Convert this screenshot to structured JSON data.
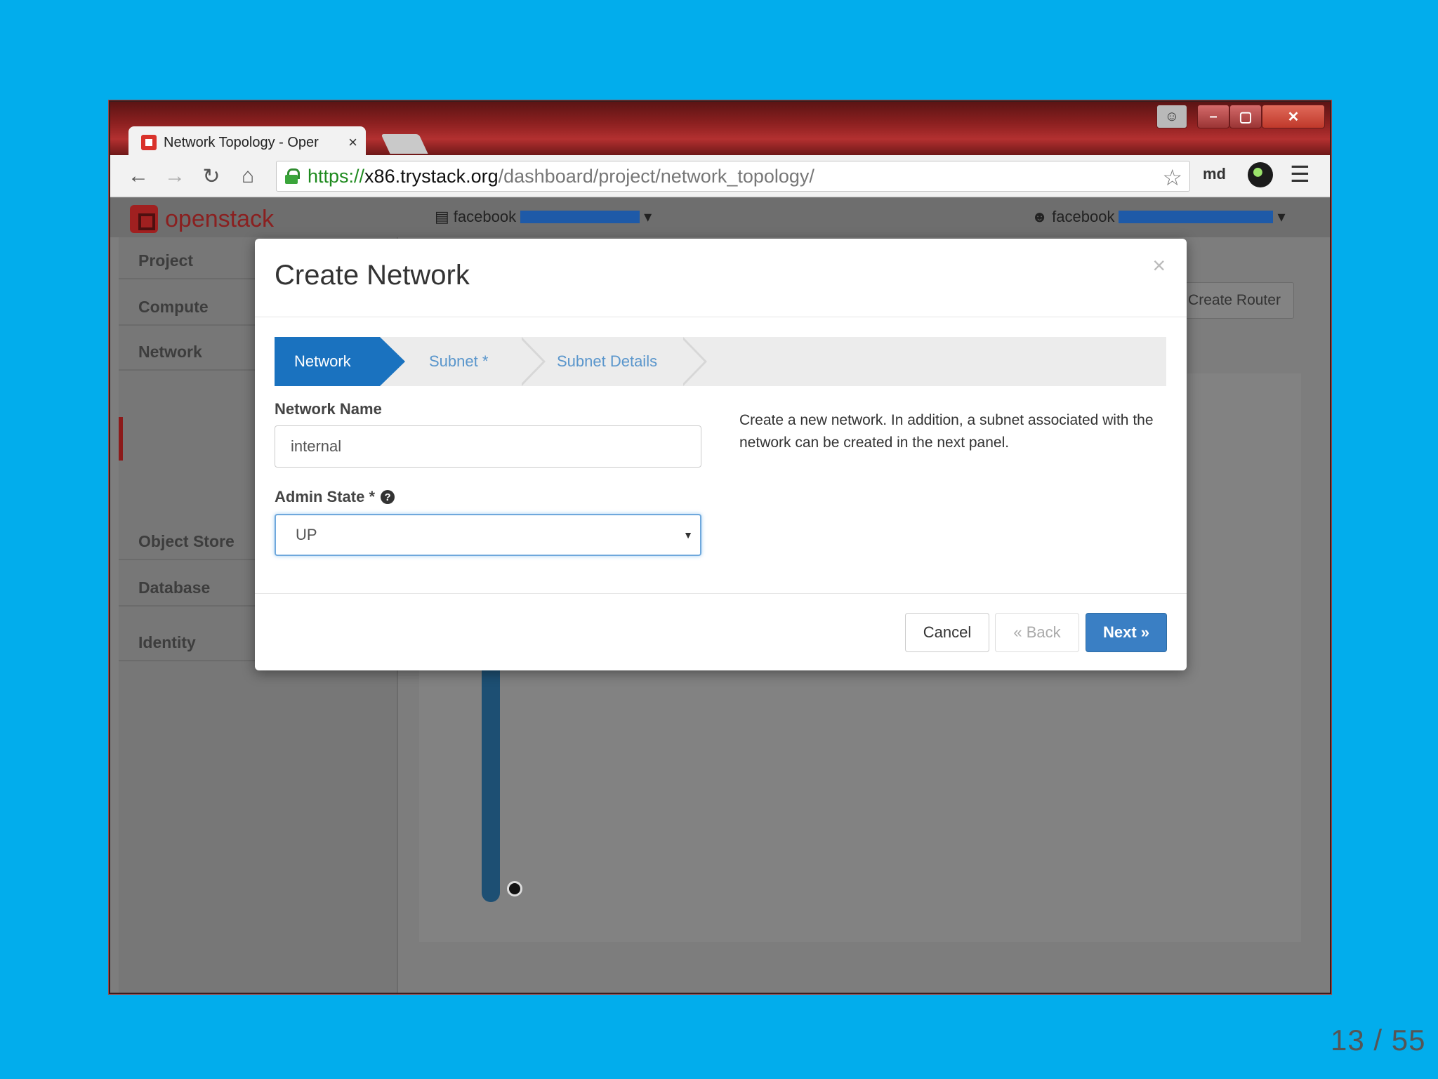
{
  "browser": {
    "tab_title": "Network Topology - Oper",
    "tab_close": "×",
    "url_scheme": "https://",
    "url_host": "x86.trystack.org",
    "url_path": "/dashboard/project/network_topology/",
    "extension_label": "md"
  },
  "openstack": {
    "logo_text": "openstack",
    "project_selector": "facebook",
    "user_selector": "facebook",
    "sidebar": [
      {
        "label": "Project"
      },
      {
        "label": "Compute"
      },
      {
        "label": "Network"
      },
      {
        "label": "Object Store"
      },
      {
        "label": "Database"
      },
      {
        "label": "Identity"
      }
    ],
    "create_router_label": "Create Router"
  },
  "modal": {
    "title": "Create Network",
    "close": "×",
    "steps": [
      {
        "label": "Network",
        "state": "active"
      },
      {
        "label": "Subnet *",
        "state": "inactive"
      },
      {
        "label": "Subnet Details",
        "state": "inactive"
      }
    ],
    "network_name_label": "Network Name",
    "network_name_value": "internal",
    "admin_state_label": "Admin State *",
    "admin_state_value": "UP",
    "help_text": "Create a new network. In addition, a subnet associated with the network can be created in the next panel.",
    "buttons": {
      "cancel": "Cancel",
      "back": "« Back",
      "next": "Next »"
    }
  },
  "slide": {
    "page_number": "13 / 55"
  },
  "colors": {
    "background": "#02adec",
    "primary_blue": "#1a72bf",
    "next_button": "#3a7fc4"
  }
}
